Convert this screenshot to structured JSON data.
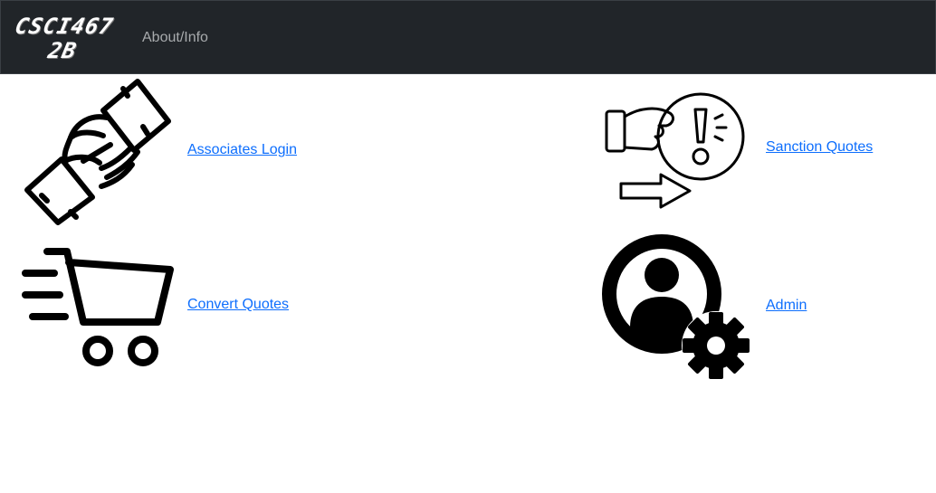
{
  "navbar": {
    "brand_line1": "CSCI467",
    "brand_line2": "2B",
    "about_link": "About/Info"
  },
  "tiles": {
    "associates": {
      "label": "Associates Login",
      "icon": "handshake-icon"
    },
    "sanction": {
      "label": "Sanction Quotes",
      "icon": "hand-alert-arrow-icon"
    },
    "convert": {
      "label": "Convert Quotes",
      "icon": "shopping-cart-icon"
    },
    "admin": {
      "label": "Admin",
      "icon": "user-gear-icon"
    }
  },
  "colors": {
    "navbar_bg": "#212529",
    "nav_text": "#a8abad",
    "link": "#0d6efd"
  }
}
